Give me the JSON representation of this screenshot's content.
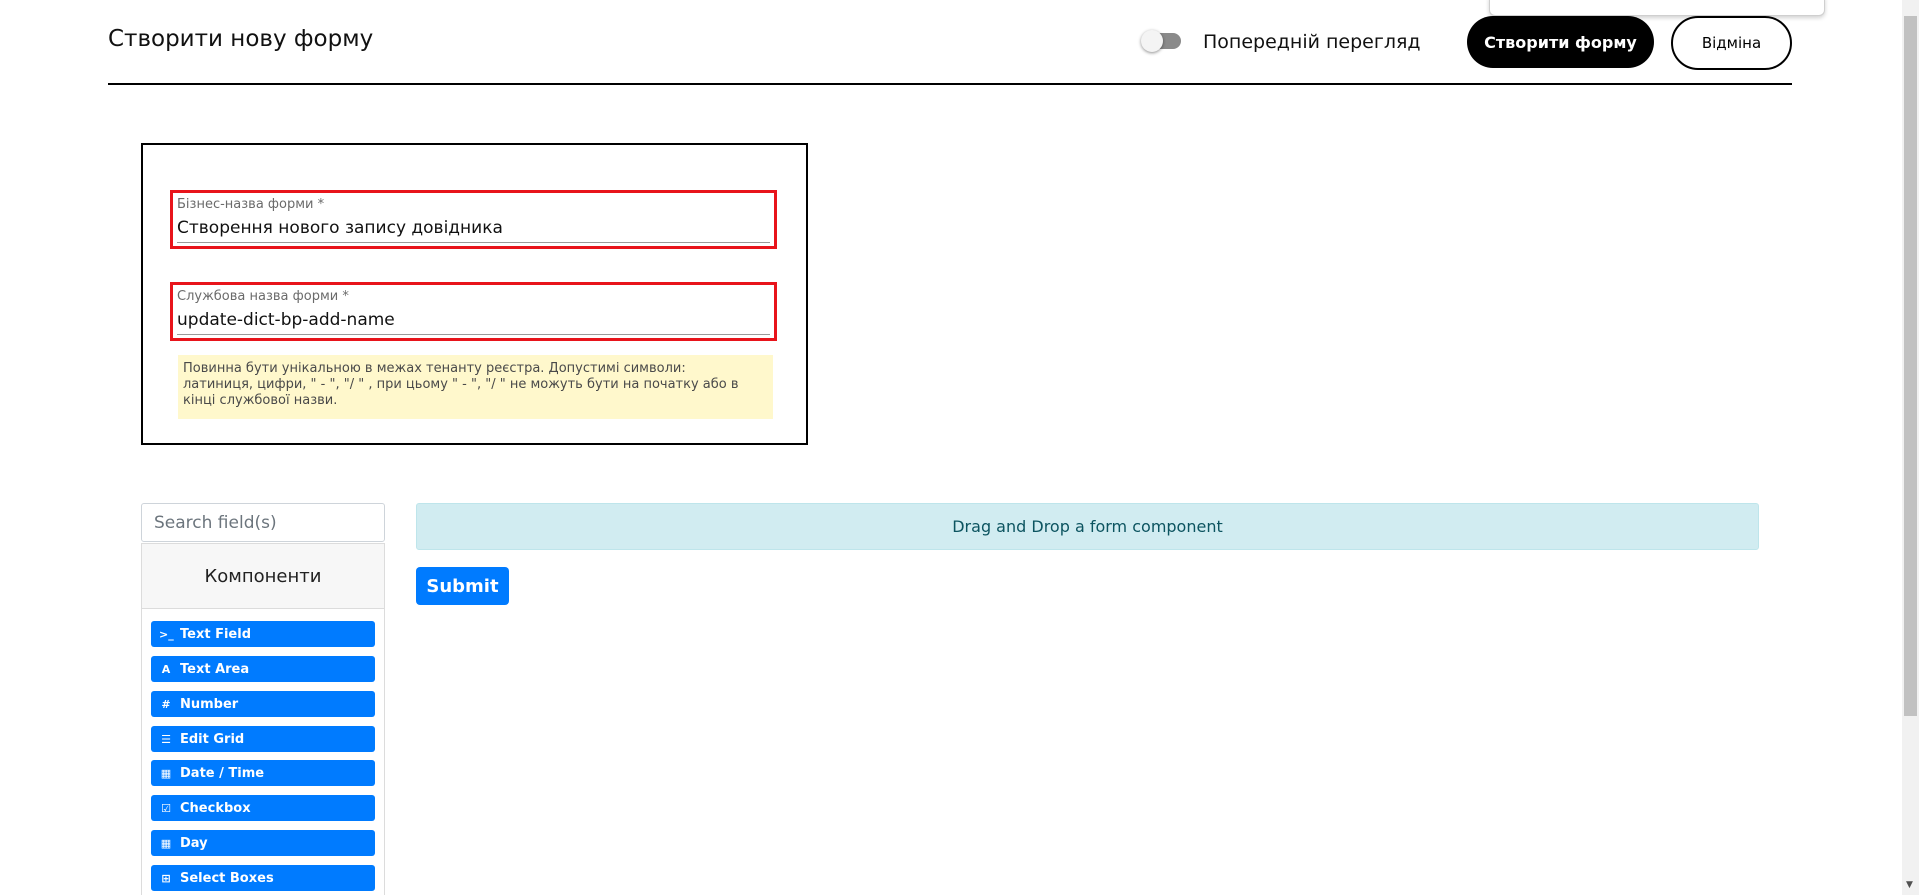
{
  "header": {
    "title": "Створити нову форму",
    "preview_label": "Попередній перегляд",
    "create_label": "Створити форму",
    "cancel_label": "Відміна"
  },
  "settings": {
    "business_name_label": "Бізнес-назва форми *",
    "business_name_value": "Створення нового запису довідника",
    "service_name_label": "Службова назва форми *",
    "service_name_value": "update-dict-bp-add-name",
    "hint_line1": "Повинна бути унікальною в межах тенанту реєстра. Допустимі символи:",
    "hint_line2": "латиниця, цифри, \" - \", \"/ \" , при цьому  \" - \", \"/ \" не можуть бути на початку або в",
    "hint_line3": "кінці службової назви."
  },
  "sidebar": {
    "search_placeholder": "Search field(s)",
    "components_title": "Компоненти",
    "items": [
      {
        "label": "Text Field",
        "icon": "terminal-icon",
        "glyph": ">_"
      },
      {
        "label": "Text Area",
        "icon": "font-icon",
        "glyph": "A"
      },
      {
        "label": "Number",
        "icon": "hashtag-icon",
        "glyph": "#"
      },
      {
        "label": "Edit Grid",
        "icon": "list-icon",
        "glyph": "☰"
      },
      {
        "label": "Date / Time",
        "icon": "calendar-icon",
        "glyph": "▦"
      },
      {
        "label": "Checkbox",
        "icon": "check-square-icon",
        "glyph": "☑"
      },
      {
        "label": "Day",
        "icon": "calendar-icon",
        "glyph": "▦"
      },
      {
        "label": "Select Boxes",
        "icon": "plus-square-icon",
        "glyph": "⊞"
      }
    ]
  },
  "builder": {
    "drop_zone_text": "Drag and Drop a form component",
    "submit_label": "Submit"
  },
  "colors": {
    "primary": "#007bff",
    "highlight_red": "#e8141b",
    "hint_bg": "#fff8cc",
    "drop_bg": "#d1ecf1"
  }
}
